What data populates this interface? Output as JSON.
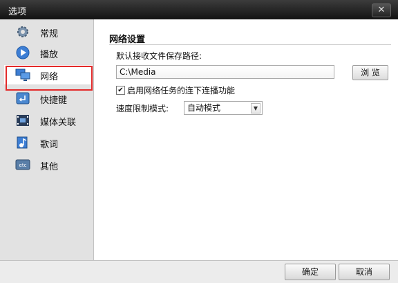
{
  "window": {
    "title": "选项",
    "close_glyph": "✕"
  },
  "sidebar": {
    "items": [
      {
        "label": "常规",
        "icon": "gear-icon"
      },
      {
        "label": "播放",
        "icon": "play-icon"
      },
      {
        "label": "网络",
        "icon": "network-icon"
      },
      {
        "label": "快捷键",
        "icon": "keyboard-icon"
      },
      {
        "label": "媒体关联",
        "icon": "media-icon"
      },
      {
        "label": "歌词",
        "icon": "lyrics-icon"
      },
      {
        "label": "其他",
        "icon": "etc-icon"
      }
    ],
    "selected": "网络"
  },
  "main": {
    "section_title": "网络设置",
    "save_path_label": "默认接收文件保存路径:",
    "save_path_value": "C:\\Media",
    "browse_label": "浏 览",
    "continue_label": "启用网络任务的连下连播功能",
    "continue_checked": true,
    "speed_label": "速度限制模式:",
    "speed_value": "自动模式"
  },
  "footer": {
    "ok_label": "确定",
    "cancel_label": "取消"
  },
  "colors": {
    "accent_red": "#e32a2a",
    "titlebar": "#1e1e1e"
  }
}
